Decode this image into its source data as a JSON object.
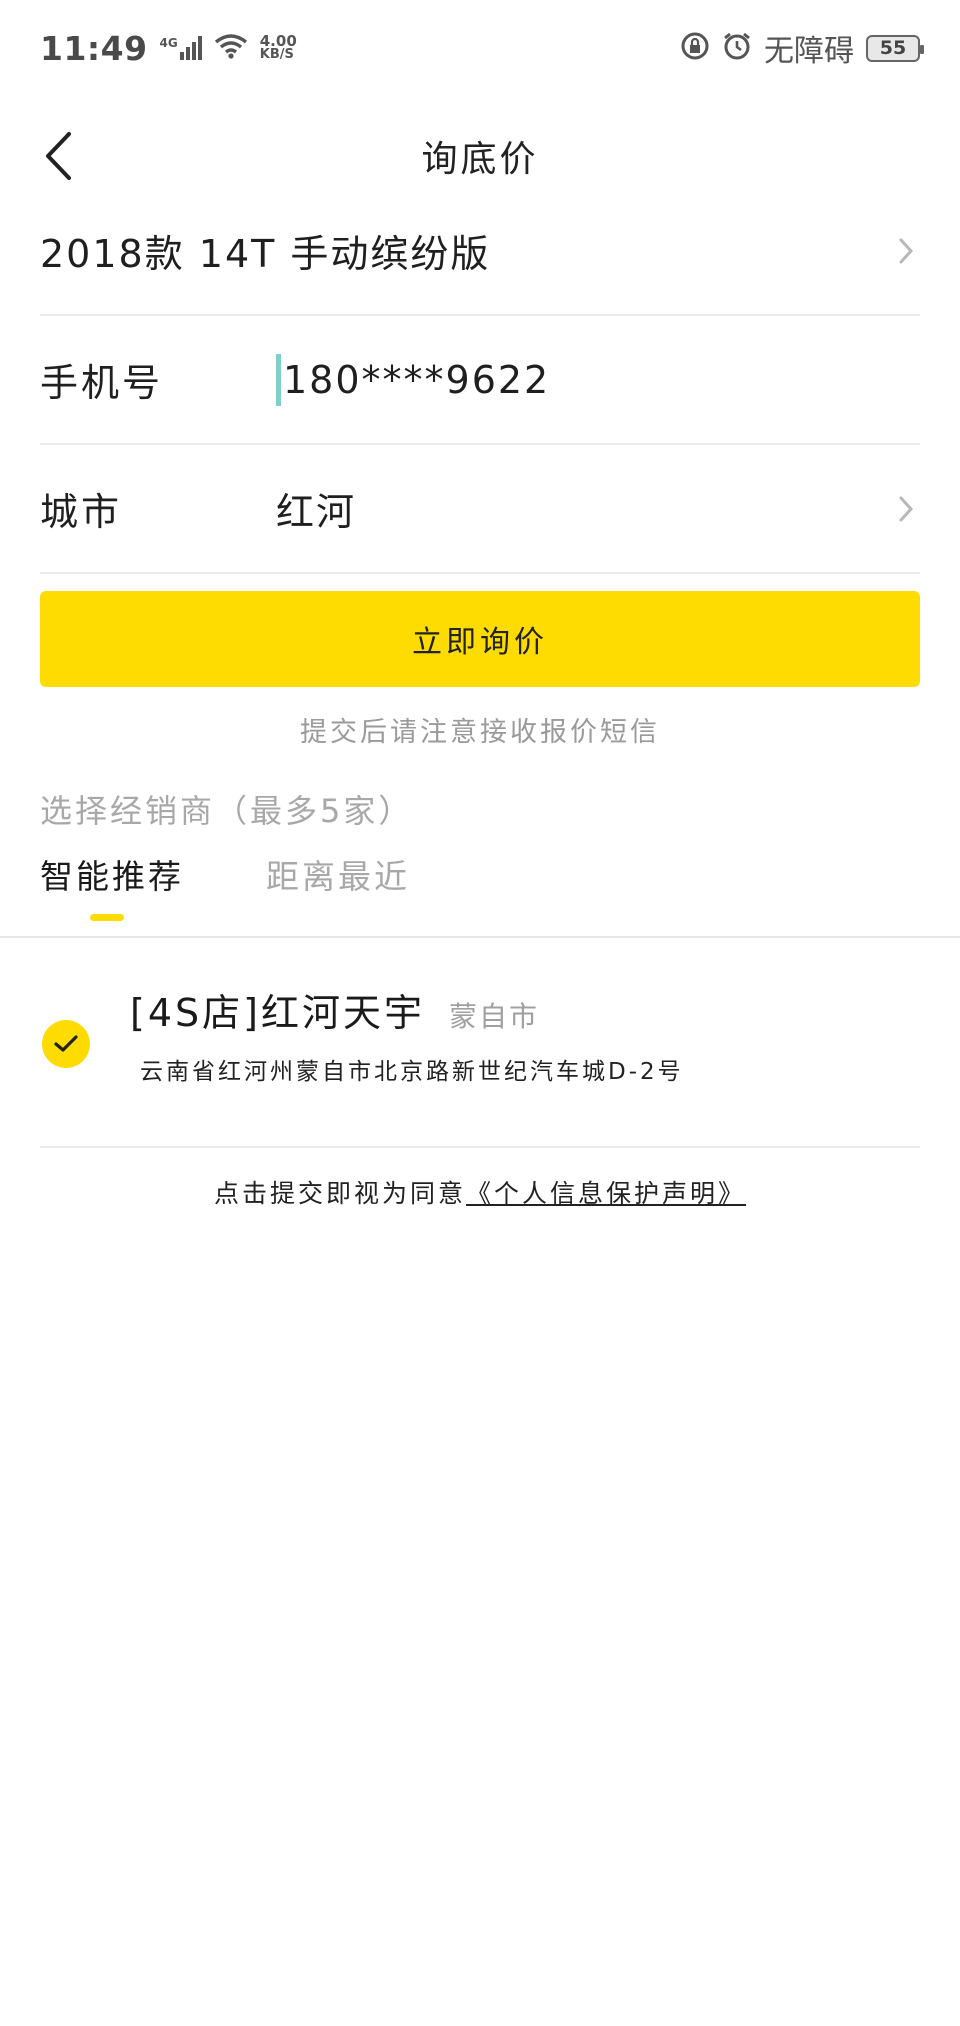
{
  "status_bar": {
    "time": "11:49",
    "network_type": "4G",
    "speed_value": "4.00",
    "speed_unit": "KB/S",
    "accessibility_text": "无障碍",
    "battery_level": "55"
  },
  "nav": {
    "title": "询底价"
  },
  "form": {
    "car_model": "2018款 14T 手动缤纷版",
    "phone_label": "手机号",
    "phone_value": "180****9622",
    "city_label": "城市",
    "city_value": "红河"
  },
  "submit_button_label": "立即询价",
  "submit_hint": "提交后请注意接收报价短信",
  "dealer_section": {
    "title": "选择经销商（最多5家）",
    "tabs": [
      {
        "label": "智能推荐",
        "active": true
      },
      {
        "label": "距离最近",
        "active": false
      }
    ],
    "dealers": [
      {
        "name": "[4S店]红河天宇",
        "city": "蒙自市",
        "address": "云南省红河州蒙自市北京路新世纪汽车城D-2号",
        "selected": true
      }
    ]
  },
  "agreement": {
    "prefix": "点击提交即视为同意",
    "link": "《个人信息保护声明》"
  },
  "colors": {
    "accent_yellow": "#fedc01",
    "cursor_teal": "#7fd0cc",
    "muted_text": "#a8a8a8"
  }
}
